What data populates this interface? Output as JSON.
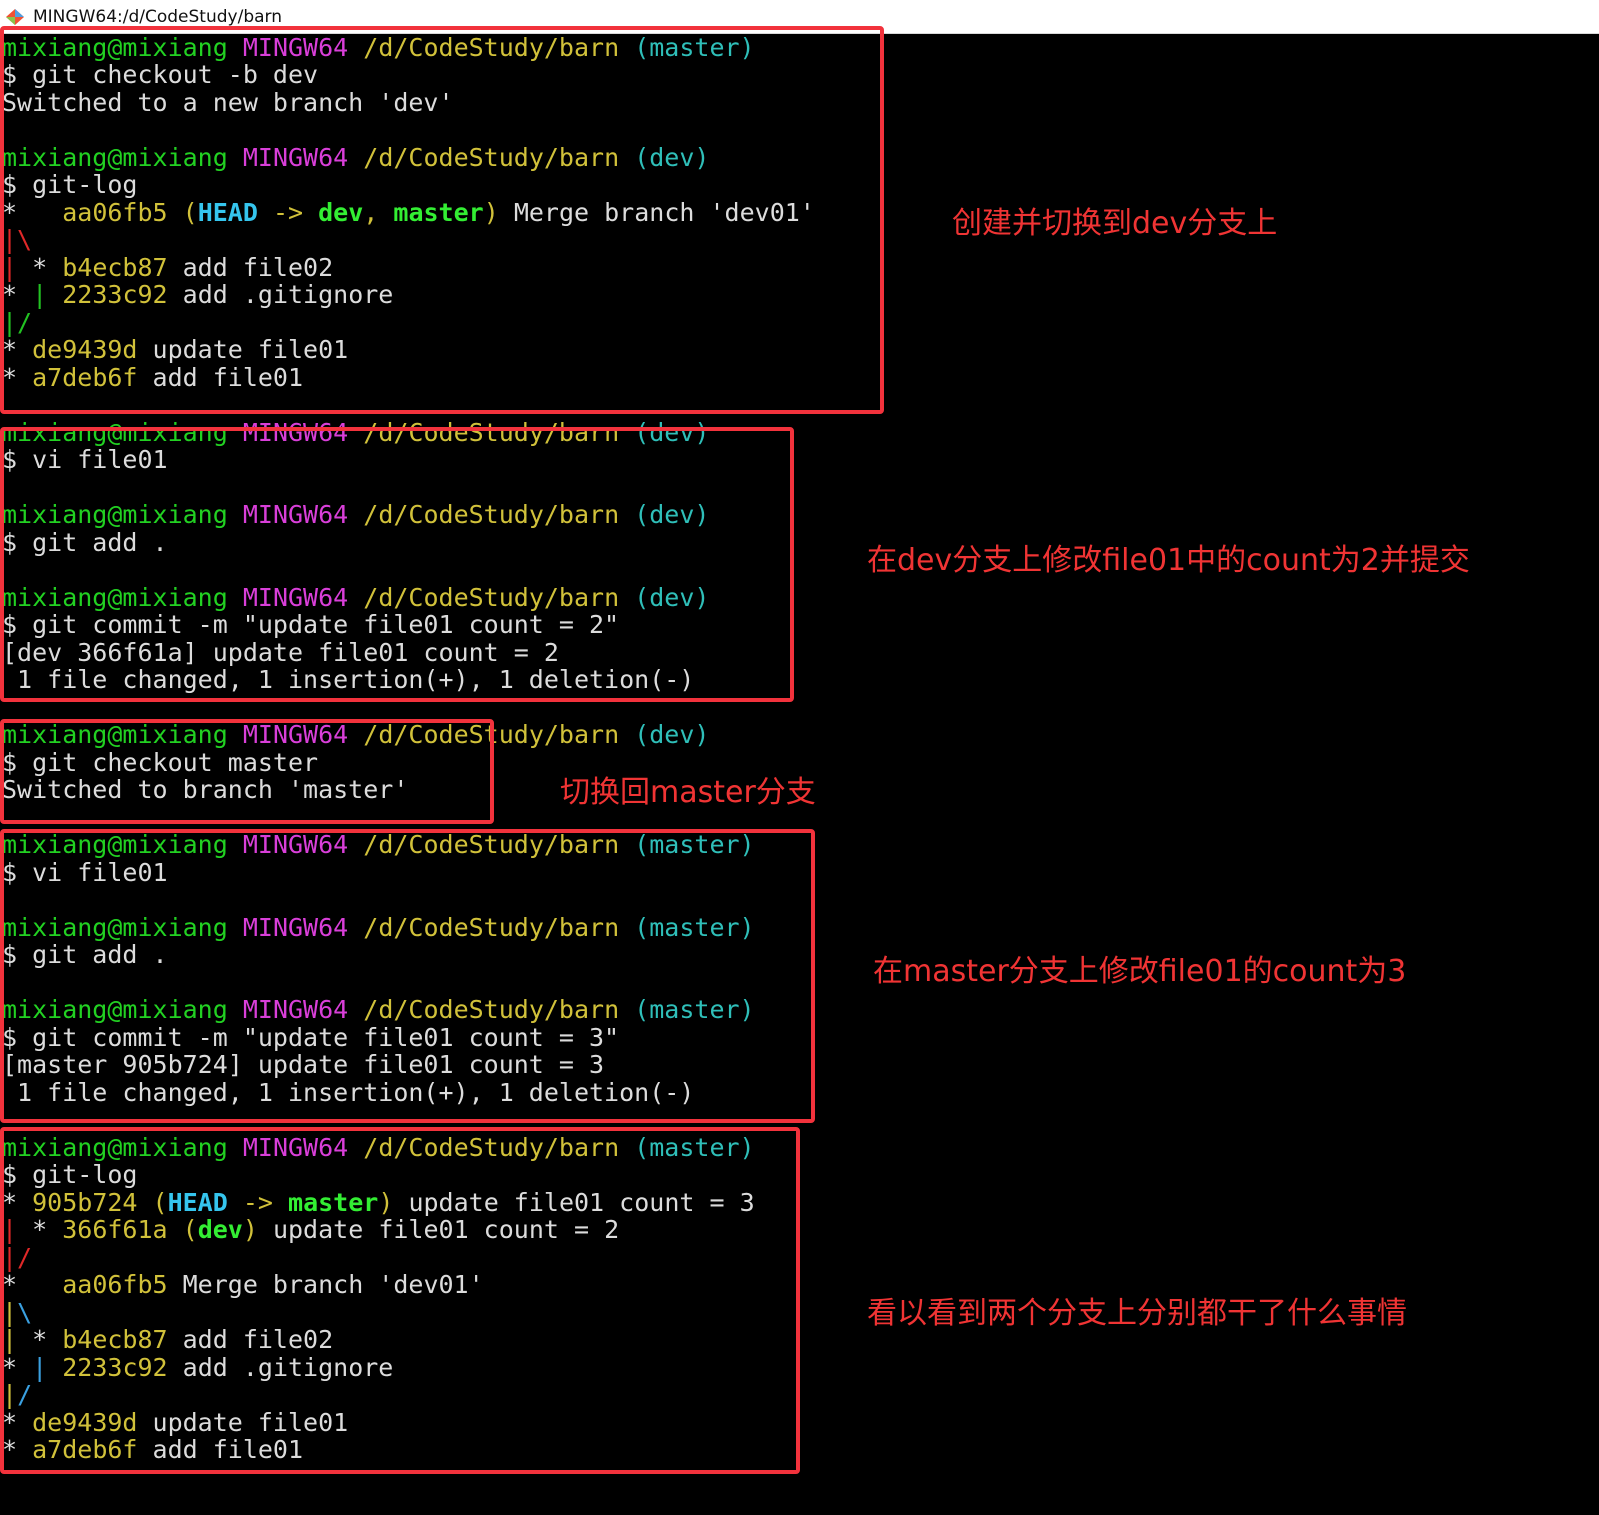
{
  "window": {
    "title": "MINGW64:/d/CodeStudy/barn"
  },
  "prompt": {
    "user_host": "mixiang@mixiang",
    "system": "MINGW64",
    "path": "/d/CodeStudy/barn"
  },
  "colors": {
    "user": "#22d122",
    "system": "#d93fd9",
    "path": "#d1c13a",
    "branch": "#2fbfb9",
    "hash": "#d1c13a",
    "head_ref": "#35c5ee",
    "branch_ref": "#33ee33",
    "annotation": "#f03434",
    "highlight_box": "#f2323c",
    "background": "#000000"
  },
  "terminal": {
    "s1": {
      "p1": "(master)",
      "c1": "$ git checkout -b dev",
      "o1": "Switched to a new branch 'dev'",
      "p2": "(dev)",
      "c2": "$ git-log",
      "l1_star": "*   ",
      "l1_hash": "aa06fb5",
      "l1_open": " (",
      "l1_head": "HEAD",
      "l1_arrow": " -> ",
      "l1_b1": "dev",
      "l1_comma": ", ",
      "l1_b2": "master",
      "l1_close": ")",
      "l1_msg": " Merge branch 'dev01'",
      "g1": "|\\",
      "l2_bar": "|",
      "l2_star": " * ",
      "l2_hash": "b4ecb87",
      "l2_msg": " add file02",
      "l3_star": "* ",
      "l3_bar": "|",
      "l3_sp": " ",
      "l3_hash": "2233c92",
      "l3_msg": " add .gitignore",
      "g2": "|/",
      "l4_star": "* ",
      "l4_hash": "de9439d",
      "l4_msg": " update file01",
      "l5_star": "* ",
      "l5_hash": "a7deb6f",
      "l5_msg": " add file01"
    },
    "s2": {
      "p1": "(dev)",
      "c1": "$ vi file01",
      "p2": "(dev)",
      "c2": "$ git add .",
      "p3": "(dev)",
      "c3": "$ git commit -m \"update file01 count = 2\"",
      "o1": "[dev 366f61a] update file01 count = 2",
      "o2": " 1 file changed, 1 insertion(+), 1 deletion(-)"
    },
    "s3": {
      "p1": "(dev)",
      "c1": "$ git checkout master",
      "o1": "Switched to branch 'master'"
    },
    "s4": {
      "p1": "(master)",
      "c1": "$ vi file01",
      "p2": "(master)",
      "c2": "$ git add .",
      "p3": "(master)",
      "c3": "$ git commit -m \"update file01 count = 3\"",
      "o1": "[master 905b724] update file01 count = 3",
      "o2": " 1 file changed, 1 insertion(+), 1 deletion(-)"
    },
    "s5": {
      "p1": "(master)",
      "c1": "$ git-log",
      "l1_star": "* ",
      "l1_hash": "905b724",
      "l1_open": " (",
      "l1_head": "HEAD",
      "l1_arrow": " -> ",
      "l1_b1": "master",
      "l1_close": ")",
      "l1_msg": " update file01 count = 3",
      "l2_bar": "|",
      "l2_star": " * ",
      "l2_hash": "366f61a",
      "l2_open": " (",
      "l2_b1": "dev",
      "l2_close": ")",
      "l2_msg": " update file01 count = 2",
      "g1": "|/",
      "l3_star": "*   ",
      "l3_hash": "aa06fb5",
      "l3_msg": " Merge branch 'dev01'",
      "g2_a": "|",
      "g2_b": "\\",
      "l4_bar": "|",
      "l4_star": " * ",
      "l4_hash": "b4ecb87",
      "l4_msg": " add file02",
      "l5_star": "* ",
      "l5_bar": "|",
      "l5_sp": " ",
      "l5_hash": "2233c92",
      "l5_msg": " add .gitignore",
      "g3_a": "|",
      "g3_b": "/",
      "l6_star": "* ",
      "l6_hash": "de9439d",
      "l6_msg": " update file01",
      "l7_star": "* ",
      "l7_hash": "a7deb6f",
      "l7_msg": " add file01"
    }
  },
  "annotations": {
    "a1": "创建并切换到dev分支上",
    "a2": "在dev分支上修改file01中的count为2并提交",
    "a3": "切换回master分支",
    "a4": "在master分支上修改file01的count为3",
    "a5": "看以看到两个分支上分别都干了什么事情"
  }
}
